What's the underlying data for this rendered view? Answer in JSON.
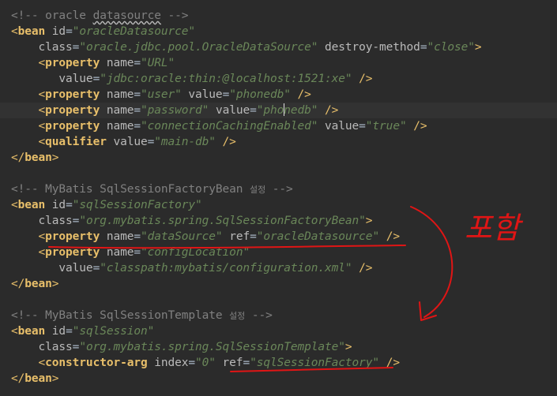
{
  "editor": {
    "lines": [
      [
        {
          "t": "<!-- oracle ",
          "c": "cmt"
        },
        {
          "t": "datasource",
          "c": "cmt wavy"
        },
        {
          "t": " -->",
          "c": "cmt"
        }
      ],
      [
        {
          "t": "<",
          "c": "punc"
        },
        {
          "t": "bean",
          "c": "tag"
        },
        {
          "t": " id",
          "c": "attr"
        },
        {
          "t": "=",
          "c": "eq"
        },
        {
          "t": "\"oracleDatasource\"",
          "c": "str"
        }
      ],
      [
        {
          "t": "    class",
          "c": "attr"
        },
        {
          "t": "=",
          "c": "eq"
        },
        {
          "t": "\"oracle.jdbc.pool.OracleDataSource\"",
          "c": "str"
        },
        {
          "t": " destroy-method",
          "c": "attr"
        },
        {
          "t": "=",
          "c": "eq"
        },
        {
          "t": "\"close\"",
          "c": "str"
        },
        {
          "t": ">",
          "c": "punc"
        }
      ],
      [
        {
          "t": "    <",
          "c": "punc"
        },
        {
          "t": "property",
          "c": "tag"
        },
        {
          "t": " name",
          "c": "attr"
        },
        {
          "t": "=",
          "c": "eq"
        },
        {
          "t": "\"URL\"",
          "c": "str"
        }
      ],
      [
        {
          "t": "       value",
          "c": "attr"
        },
        {
          "t": "=",
          "c": "eq"
        },
        {
          "t": "\"jdbc:oracle:thin:@localhost:1521:xe\"",
          "c": "str"
        },
        {
          "t": " />",
          "c": "punc"
        }
      ],
      [
        {
          "t": "    <",
          "c": "punc"
        },
        {
          "t": "property",
          "c": "tag"
        },
        {
          "t": " name",
          "c": "attr"
        },
        {
          "t": "=",
          "c": "eq"
        },
        {
          "t": "\"user\"",
          "c": "str"
        },
        {
          "t": " value",
          "c": "attr"
        },
        {
          "t": "=",
          "c": "eq"
        },
        {
          "t": "\"phonedb\"",
          "c": "str"
        },
        {
          "t": " />",
          "c": "punc"
        }
      ],
      [
        {
          "t": "    <",
          "c": "punc"
        },
        {
          "t": "property",
          "c": "tag"
        },
        {
          "t": " name",
          "c": "attr"
        },
        {
          "t": "=",
          "c": "eq"
        },
        {
          "t": "\"password\"",
          "c": "str"
        },
        {
          "t": " value",
          "c": "attr"
        },
        {
          "t": "=",
          "c": "eq"
        },
        {
          "t": "\"pho",
          "c": "str"
        },
        {
          "caret": true
        },
        {
          "t": "nedb\"",
          "c": "str"
        },
        {
          "t": " />",
          "c": "punc"
        }
      ],
      [
        {
          "t": "    <",
          "c": "punc"
        },
        {
          "t": "property",
          "c": "tag"
        },
        {
          "t": " name",
          "c": "attr"
        },
        {
          "t": "=",
          "c": "eq"
        },
        {
          "t": "\"connectionCachingEnabled\"",
          "c": "str"
        },
        {
          "t": " value",
          "c": "attr"
        },
        {
          "t": "=",
          "c": "eq"
        },
        {
          "t": "\"true\"",
          "c": "str"
        },
        {
          "t": " />",
          "c": "punc"
        }
      ],
      [
        {
          "t": "    <",
          "c": "punc"
        },
        {
          "t": "qualifier",
          "c": "tag"
        },
        {
          "t": " value",
          "c": "attr"
        },
        {
          "t": "=",
          "c": "eq"
        },
        {
          "t": "\"main-db\"",
          "c": "str"
        },
        {
          "t": " />",
          "c": "punc"
        }
      ],
      [
        {
          "t": "</",
          "c": "punc"
        },
        {
          "t": "bean",
          "c": "tag"
        },
        {
          "t": ">",
          "c": "punc"
        }
      ],
      [],
      [
        {
          "t": "<!-- MyBatis SqlSessionFactoryBean ",
          "c": "cmt"
        },
        {
          "t": "설정",
          "c": "cmt-kr"
        },
        {
          "t": " -->",
          "c": "cmt"
        }
      ],
      [
        {
          "t": "<",
          "c": "punc"
        },
        {
          "t": "bean",
          "c": "tag"
        },
        {
          "t": " id",
          "c": "attr"
        },
        {
          "t": "=",
          "c": "eq"
        },
        {
          "t": "\"sqlSessionFactory\"",
          "c": "str"
        }
      ],
      [
        {
          "t": "    class",
          "c": "attr"
        },
        {
          "t": "=",
          "c": "eq"
        },
        {
          "t": "\"org.mybatis.spring.SqlSessionFactoryBean\"",
          "c": "str"
        },
        {
          "t": ">",
          "c": "punc"
        }
      ],
      [
        {
          "t": "    <",
          "c": "punc"
        },
        {
          "t": "property",
          "c": "tag"
        },
        {
          "t": " name",
          "c": "attr"
        },
        {
          "t": "=",
          "c": "eq"
        },
        {
          "t": "\"dataSource\"",
          "c": "str"
        },
        {
          "t": " ref",
          "c": "attr"
        },
        {
          "t": "=",
          "c": "eq"
        },
        {
          "t": "\"oracleDatasource\"",
          "c": "str"
        },
        {
          "t": " />",
          "c": "punc"
        }
      ],
      [
        {
          "t": "    <",
          "c": "punc"
        },
        {
          "t": "property",
          "c": "tag"
        },
        {
          "t": " name",
          "c": "attr"
        },
        {
          "t": "=",
          "c": "eq"
        },
        {
          "t": "\"configLocation\"",
          "c": "str"
        }
      ],
      [
        {
          "t": "       value",
          "c": "attr"
        },
        {
          "t": "=",
          "c": "eq"
        },
        {
          "t": "\"classpath:mybatis/configuration.xml\"",
          "c": "str"
        },
        {
          "t": " />",
          "c": "punc"
        }
      ],
      [
        {
          "t": "</",
          "c": "punc"
        },
        {
          "t": "bean",
          "c": "tag"
        },
        {
          "t": ">",
          "c": "punc"
        }
      ],
      [],
      [
        {
          "t": "<!-- MyBatis SqlSessionTemplate ",
          "c": "cmt"
        },
        {
          "t": "설정",
          "c": "cmt-kr"
        },
        {
          "t": " -->",
          "c": "cmt"
        }
      ],
      [
        {
          "t": "<",
          "c": "punc"
        },
        {
          "t": "bean",
          "c": "tag"
        },
        {
          "t": " id",
          "c": "attr"
        },
        {
          "t": "=",
          "c": "eq"
        },
        {
          "t": "\"sqlSession\"",
          "c": "str"
        }
      ],
      [
        {
          "t": "    class",
          "c": "attr"
        },
        {
          "t": "=",
          "c": "eq"
        },
        {
          "t": "\"org.mybatis.spring.SqlSessionTemplate\"",
          "c": "str"
        },
        {
          "t": ">",
          "c": "punc"
        }
      ],
      [
        {
          "t": "    <",
          "c": "punc"
        },
        {
          "t": "constructor-arg",
          "c": "tag"
        },
        {
          "t": " index",
          "c": "attr"
        },
        {
          "t": "=",
          "c": "eq"
        },
        {
          "t": "\"0\"",
          "c": "str"
        },
        {
          "t": " ref",
          "c": "attr"
        },
        {
          "t": "=",
          "c": "eq"
        },
        {
          "t": "\"sqlSessionFactory\"",
          "c": "str"
        },
        {
          "t": " />",
          "c": "punc"
        }
      ],
      [
        {
          "t": "</",
          "c": "punc"
        },
        {
          "t": "bean",
          "c": "tag"
        },
        {
          "t": ">",
          "c": "punc"
        }
      ]
    ],
    "caret_line": 6
  },
  "annotation": {
    "text": "포함",
    "color": "#e01515"
  }
}
